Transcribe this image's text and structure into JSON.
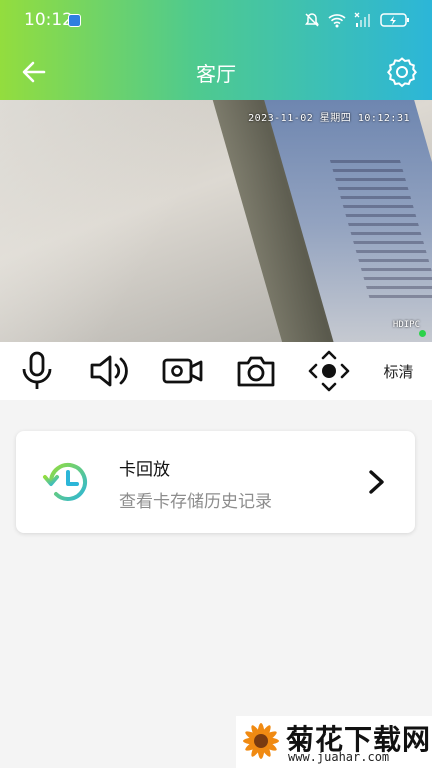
{
  "status_bar": {
    "time": "10:12"
  },
  "header": {
    "title": "客厅"
  },
  "video": {
    "timestamp": "2023-11-02  星期四  10:12:31",
    "label": "HDIPC"
  },
  "controls": {
    "quality_label": "标清"
  },
  "playback_card": {
    "title": "卡回放",
    "subtitle": "查看卡存储历史记录"
  },
  "watermark": {
    "name": "菊花下载网",
    "url": "www.juahar.com"
  },
  "colors": {
    "accent_green": "#93dd3e",
    "accent_blue": "#2cb6d8",
    "live_indicator": "#2bd24a"
  }
}
